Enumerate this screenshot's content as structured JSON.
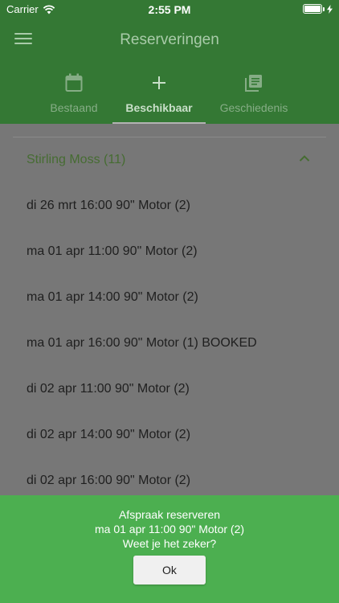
{
  "status_bar": {
    "carrier": "Carrier",
    "time": "2:55 PM",
    "battery_level": 1.0
  },
  "header": {
    "title": "Reserveringen"
  },
  "tabs": [
    {
      "label": "Bestaand",
      "icon": "calendar-icon",
      "active": false
    },
    {
      "label": "Beschikbaar",
      "icon": "plus-icon",
      "active": true
    },
    {
      "label": "Geschiedenis",
      "icon": "library-books-icon",
      "active": false
    }
  ],
  "section": {
    "title": "Stirling Moss (11)",
    "expanded": true
  },
  "items": [
    {
      "label": "di 26 mrt 16:00 90\" Motor (2)"
    },
    {
      "label": "ma 01 apr 11:00 90\" Motor (2)"
    },
    {
      "label": "ma 01 apr 14:00 90\" Motor (2)"
    },
    {
      "label": "ma 01 apr 16:00 90\" Motor (1) BOOKED"
    },
    {
      "label": "di 02 apr 11:00 90\" Motor (2)"
    },
    {
      "label": "di 02 apr 14:00 90\" Motor (2)"
    },
    {
      "label": "di 02 apr 16:00 90\" Motor (2)"
    }
  ],
  "dialog": {
    "line1": "Afspraak reserveren",
    "line2": "ma 01 apr 11:00 90\" Motor (2)",
    "line3": "Weet je het zeker?",
    "ok_label": "Ok"
  },
  "colors": {
    "header": "#347834",
    "dialog": "#4caf50",
    "section_title": "#466c32",
    "overlay_bg": "#777777"
  }
}
